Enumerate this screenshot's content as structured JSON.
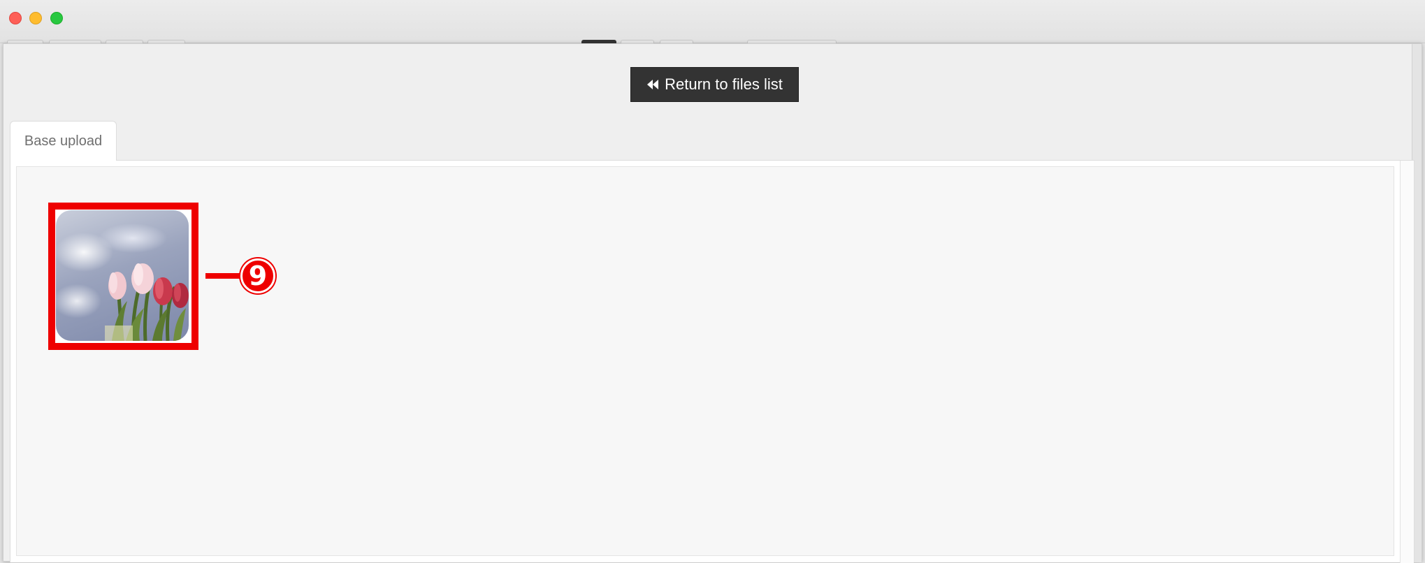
{
  "window": {
    "controls": [
      "close",
      "minimize",
      "maximize"
    ]
  },
  "toolbar": {
    "return_label": "Return to files list",
    "return_icon": "fast-backward-icon"
  },
  "tabs": [
    {
      "label": "Base upload",
      "active": true
    }
  ],
  "upload": {
    "thumbnail_alt": "Tulips against cloudy sky",
    "annotation_number": "9"
  },
  "colors": {
    "button_bg": "#333333",
    "annotation_red": "#ee0000",
    "panel_bg": "#f7f7f7"
  }
}
